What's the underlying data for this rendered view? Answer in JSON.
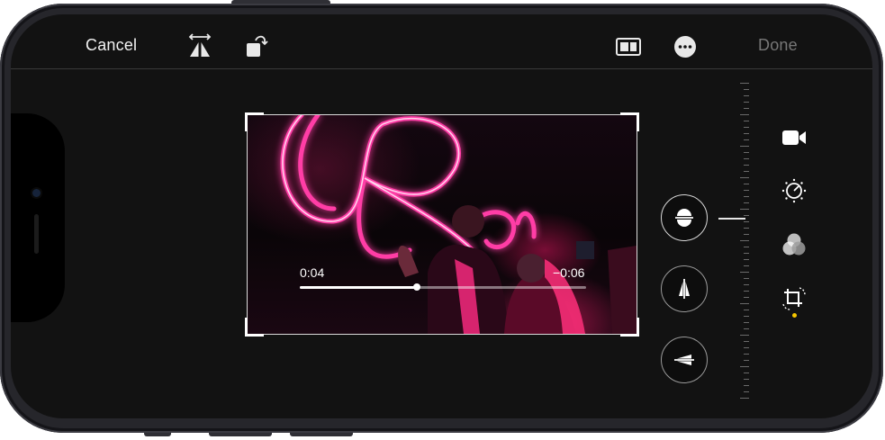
{
  "top_bar": {
    "cancel_label": "Cancel",
    "done_label": "Done",
    "icons": [
      "flip-horizontal-icon",
      "rotate-icon",
      "aspect-ratio-icon",
      "more-options-icon"
    ]
  },
  "video": {
    "elapsed": "0:04",
    "remaining": "−0:06",
    "progress": 0.41
  },
  "perspective_tools": [
    "straighten-icon",
    "vertical-perspective-icon",
    "horizontal-perspective-icon"
  ],
  "side_tools": {
    "items": [
      "video-camera-icon",
      "adjust-dial-icon",
      "filters-icon",
      "crop-rotate-icon"
    ],
    "active": "crop-rotate-icon",
    "active_indicator_color": "#f6c700"
  },
  "colors": {
    "background": "#121212",
    "text_primary": "#f2f2f2",
    "text_disabled": "#777777",
    "neon": "#ff2f9a"
  }
}
